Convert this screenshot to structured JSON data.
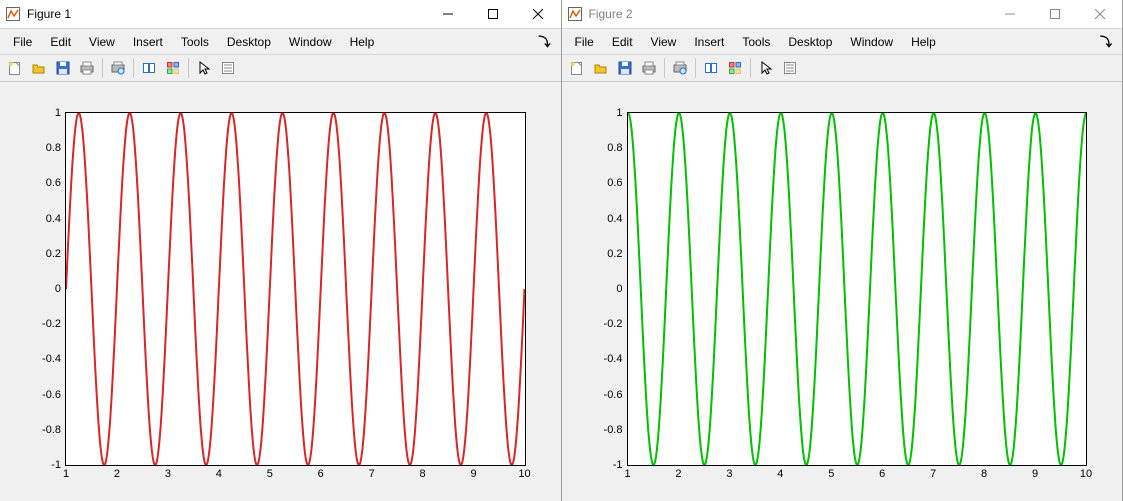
{
  "windows": [
    {
      "title": "Figure 1",
      "active": true,
      "chart_data": {
        "type": "line",
        "function": "sin(2*pi*(x-1))",
        "x_range": [
          1,
          10
        ],
        "y_range": [
          -1,
          1
        ],
        "color": "#d62728",
        "xticks": [
          1,
          2,
          3,
          4,
          5,
          6,
          7,
          8,
          9,
          10
        ],
        "yticks": [
          -1,
          -0.8,
          -0.6,
          -0.4,
          -0.2,
          0,
          0.2,
          0.4,
          0.6,
          0.8,
          1
        ],
        "xlabel": "",
        "ylabel": "",
        "title": ""
      }
    },
    {
      "title": "Figure 2",
      "active": false,
      "chart_data": {
        "type": "line",
        "function": "cos(2*pi*(x-1))",
        "x_range": [
          1,
          10
        ],
        "y_range": [
          -1,
          1
        ],
        "color": "#00c000",
        "xticks": [
          1,
          2,
          3,
          4,
          5,
          6,
          7,
          8,
          9,
          10
        ],
        "yticks": [
          -1,
          -0.8,
          -0.6,
          -0.4,
          -0.2,
          0,
          0.2,
          0.4,
          0.6,
          0.8,
          1
        ],
        "xlabel": "",
        "ylabel": "",
        "title": ""
      }
    }
  ],
  "menus": [
    "File",
    "Edit",
    "View",
    "Insert",
    "Tools",
    "Desktop",
    "Window",
    "Help"
  ],
  "toolbar_names": [
    "new-figure",
    "open",
    "save",
    "print",
    "_sep",
    "print-preview",
    "_sep",
    "link",
    "tile",
    "_sep",
    "pointer",
    "properties"
  ],
  "chart_data": [
    {
      "type": "line",
      "function": "sin(2*pi*(x-1))",
      "x_range": [
        1,
        10
      ],
      "y_range": [
        -1,
        1
      ],
      "color": "#d62728",
      "xticks": [
        1,
        2,
        3,
        4,
        5,
        6,
        7,
        8,
        9,
        10
      ],
      "yticks": [
        -1,
        -0.8,
        -0.6,
        -0.4,
        -0.2,
        0,
        0.2,
        0.4,
        0.6,
        0.8,
        1
      ],
      "title": "",
      "xlabel": "",
      "ylabel": ""
    },
    {
      "type": "line",
      "function": "cos(2*pi*(x-1))",
      "x_range": [
        1,
        10
      ],
      "y_range": [
        -1,
        1
      ],
      "color": "#00c000",
      "xticks": [
        1,
        2,
        3,
        4,
        5,
        6,
        7,
        8,
        9,
        10
      ],
      "yticks": [
        -1,
        -0.8,
        -0.6,
        -0.4,
        -0.2,
        0,
        0.2,
        0.4,
        0.6,
        0.8,
        1
      ],
      "title": "",
      "xlabel": "",
      "ylabel": ""
    }
  ]
}
